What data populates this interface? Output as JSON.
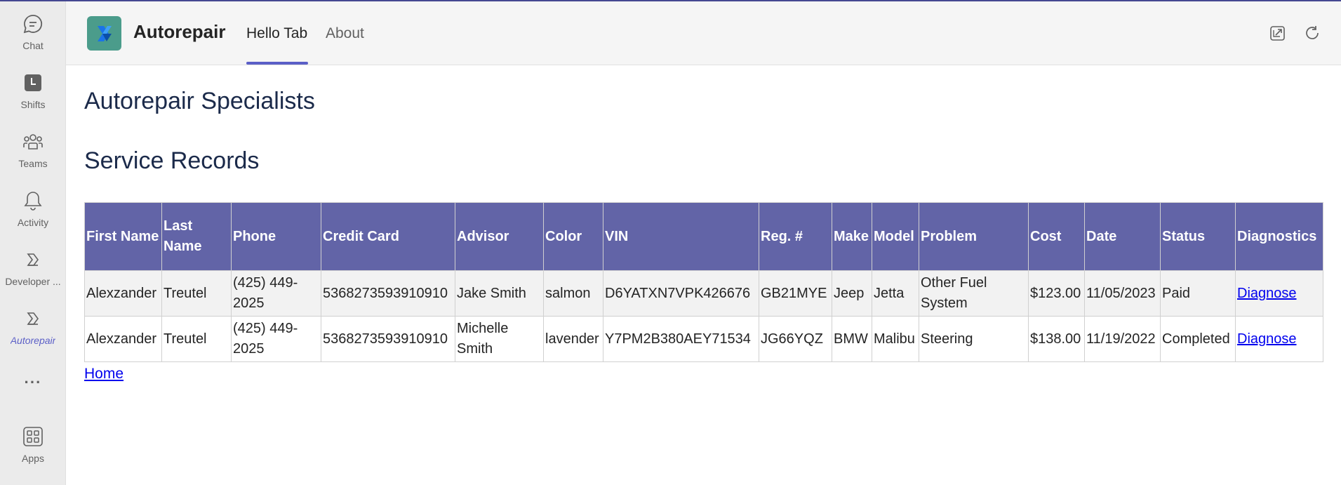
{
  "rail": {
    "items": [
      {
        "label": "Chat",
        "icon": "chat-icon"
      },
      {
        "label": "Shifts",
        "icon": "shifts-icon"
      },
      {
        "label": "Teams",
        "icon": "teams-icon"
      },
      {
        "label": "Activity",
        "icon": "bell-icon"
      },
      {
        "label": "Developer ...",
        "icon": "developer-portal-icon"
      },
      {
        "label": "Autorepair",
        "icon": "autorepair-icon"
      },
      {
        "label": "Apps",
        "icon": "apps-icon"
      }
    ],
    "more": "···",
    "accent_color": "#5b5fc7"
  },
  "header": {
    "app_name": "Autorepair",
    "tabs": [
      {
        "label": "Hello Tab",
        "active": true
      },
      {
        "label": "About",
        "active": false
      }
    ],
    "actions": [
      "popout-icon",
      "refresh-icon"
    ]
  },
  "main": {
    "title": "Autorepair Specialists",
    "section_title": "Service Records",
    "table": {
      "header_color": "#6264a7",
      "columns": [
        "First Name",
        "Last Name",
        "Phone",
        "Credit Card",
        "Advisor",
        "Color",
        "VIN",
        "Reg. #",
        "Make",
        "Model",
        "Problem",
        "Cost",
        "Date",
        "Status",
        "Diagnostics"
      ],
      "rows": [
        [
          "Alexzander",
          "Treutel",
          "(425) 449-2025",
          "5368273593910910",
          "Jake Smith",
          "salmon",
          "D6YATXN7VPK426676",
          "GB21MYE",
          "Jeep",
          "Jetta",
          "Other Fuel System",
          "$123.00",
          "11/05/2023",
          "Paid",
          "Diagnose"
        ],
        [
          "Alexzander",
          "Treutel",
          "(425) 449-2025",
          "5368273593910910",
          "Michelle Smith",
          "lavender",
          "Y7PM2B380AEY71534",
          "JG66YQZ",
          "BMW",
          "Malibu",
          "Steering",
          "$138.00",
          "11/19/2022",
          "Completed",
          "Diagnose"
        ]
      ]
    },
    "home_link": "Home"
  }
}
